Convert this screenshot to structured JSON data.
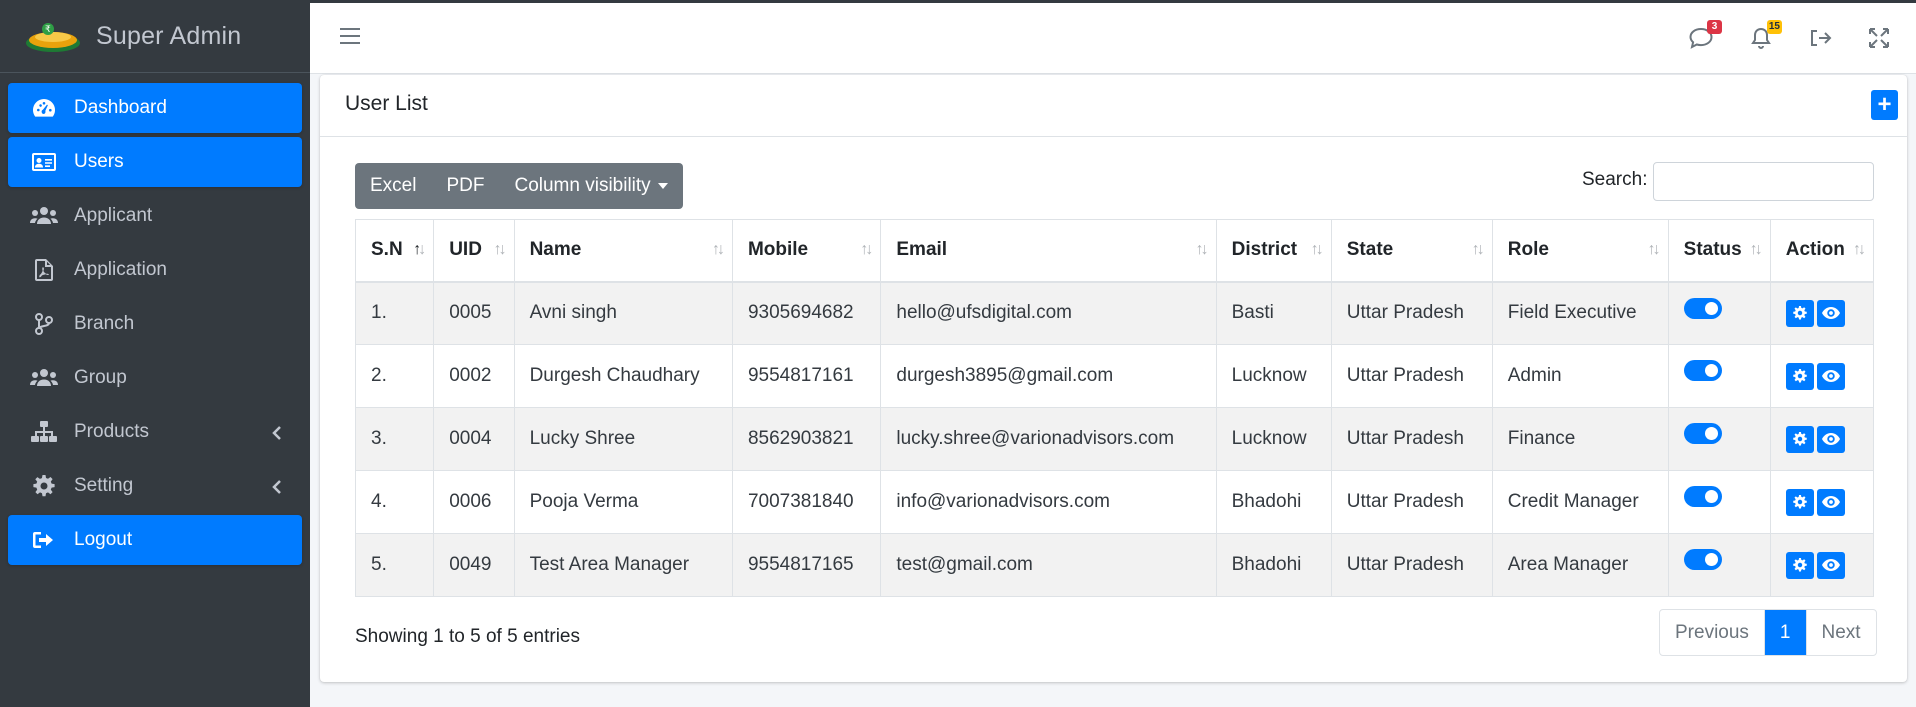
{
  "brand": {
    "title": "Super Admin"
  },
  "sidebar": {
    "items": [
      {
        "label": "Dashboard",
        "icon": "tachometer-icon",
        "active": true
      },
      {
        "label": "Users",
        "icon": "id-card-icon",
        "active": true
      },
      {
        "label": "Applicant",
        "icon": "users-icon",
        "active": false
      },
      {
        "label": "Application",
        "icon": "file-pdf-icon",
        "active": false
      },
      {
        "label": "Branch",
        "icon": "code-branch-icon",
        "active": false
      },
      {
        "label": "Group",
        "icon": "users-icon",
        "active": false
      },
      {
        "label": "Products",
        "icon": "sitemap-icon",
        "active": false,
        "submenu": true
      },
      {
        "label": "Setting",
        "icon": "gear-icon",
        "active": false,
        "submenu": true
      },
      {
        "label": "Logout",
        "icon": "sign-out-icon",
        "active": true
      }
    ]
  },
  "header": {
    "messages_badge": "3",
    "notifications_badge": "15",
    "badge_colors": {
      "messages": "#dc3545",
      "notifications": "#ffc107"
    }
  },
  "card": {
    "title": "User List",
    "add_label": "+",
    "buttons": {
      "excel": "Excel",
      "pdf": "PDF",
      "column_visibility": "Column visibility"
    },
    "search_label": "Search:",
    "search_value": ""
  },
  "table": {
    "columns": [
      "S.N",
      "UID",
      "Name",
      "Mobile",
      "Email",
      "District",
      "State",
      "Role",
      "Status",
      "Action"
    ],
    "rows": [
      {
        "sn": "1.",
        "uid": "0005",
        "name": "Avni singh",
        "mobile": "9305694682",
        "email": "hello@ufsdigital.com",
        "district": "Basti",
        "state": "Uttar Pradesh",
        "role": "Field Executive",
        "status": true
      },
      {
        "sn": "2.",
        "uid": "0002",
        "name": "Durgesh Chaudhary",
        "mobile": "9554817161",
        "email": "durgesh3895@gmail.com",
        "district": "Lucknow",
        "state": "Uttar Pradesh",
        "role": "Admin",
        "status": true
      },
      {
        "sn": "3.",
        "uid": "0004",
        "name": "Lucky Shree",
        "mobile": "8562903821",
        "email": "lucky.shree@varionadvisors.com",
        "district": "Lucknow",
        "state": "Uttar Pradesh",
        "role": "Finance",
        "status": true
      },
      {
        "sn": "4.",
        "uid": "0006",
        "name": "Pooja Verma",
        "mobile": "7007381840",
        "email": "info@varionadvisors.com",
        "district": "Bhadohi",
        "state": "Uttar Pradesh",
        "role": "Credit Manager",
        "status": true
      },
      {
        "sn": "5.",
        "uid": "0049",
        "name": "Test Area Manager",
        "mobile": "9554817165",
        "email": "test@gmail.com",
        "district": "Bhadohi",
        "state": "Uttar Pradesh",
        "role": "Area Manager",
        "status": true
      }
    ]
  },
  "footer": {
    "info": "Showing 1 to 5 of 5 entries",
    "previous": "Previous",
    "current_page": "1",
    "next": "Next"
  },
  "colors": {
    "primary": "#007bff",
    "sidebar_bg": "#343a40",
    "secondary": "#6c757d"
  }
}
